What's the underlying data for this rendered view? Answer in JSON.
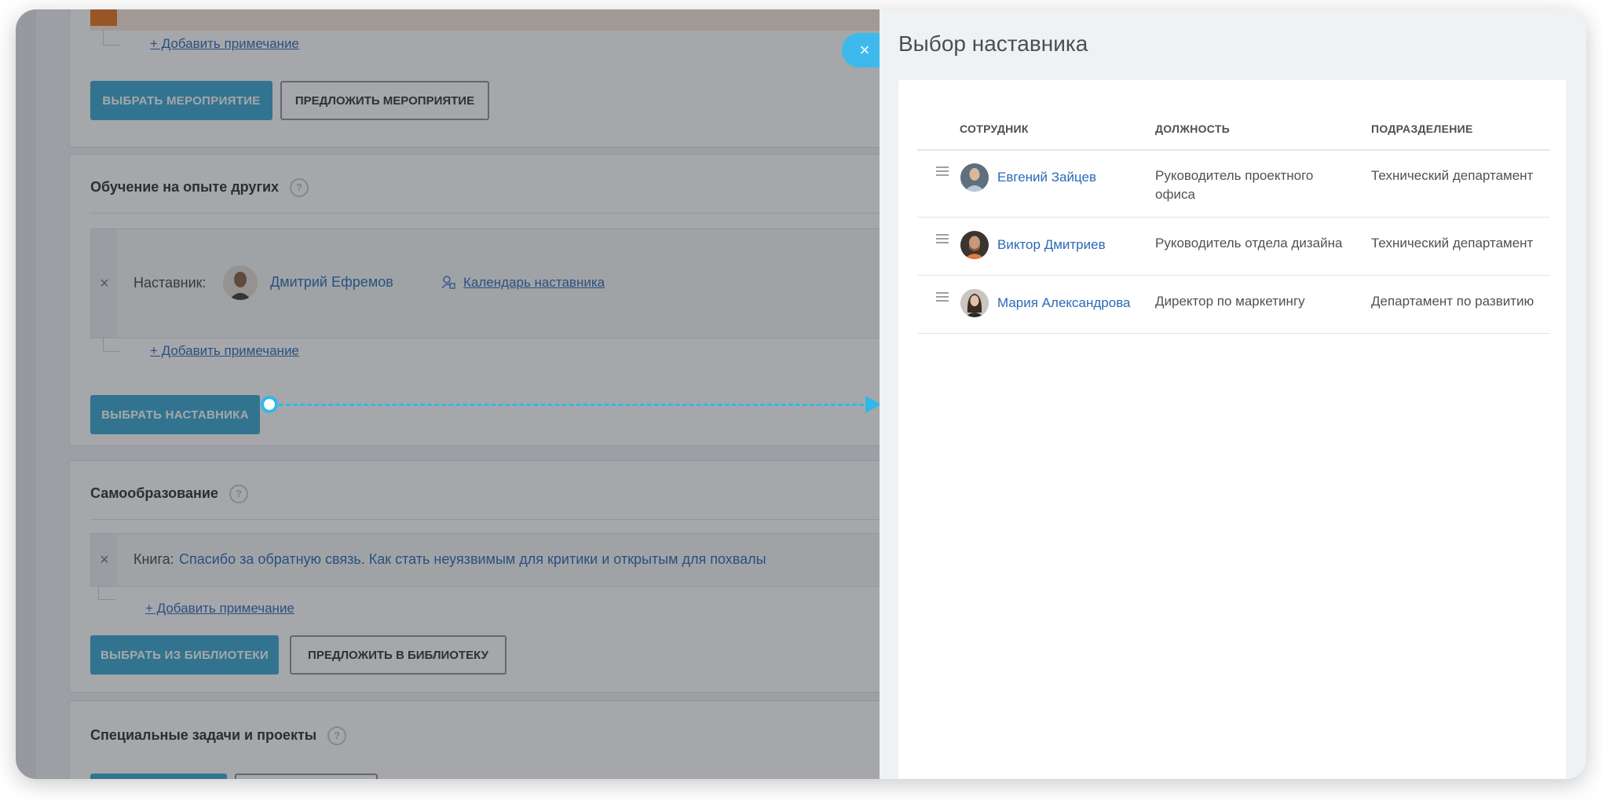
{
  "background_page": {
    "top_card": {
      "add_note": "+ Добавить примечание",
      "select_button": "Выбрать  мероприятие",
      "suggest_button": "Предложить мероприятие"
    },
    "mentoring_card": {
      "title": "Обучение на опыте других",
      "help": "?",
      "remove_icon": "×",
      "mentor_label": "Наставник:",
      "mentor_name": "Дмитрий Ефремов",
      "calendar_link": "Календарь наставника",
      "add_note": "+ Добавить примечание",
      "select_button": "Выбрать наставника"
    },
    "self_education_card": {
      "title": "Самообразование",
      "help": "?",
      "remove_icon": "×",
      "book_label": "Книга:",
      "book_title": "Спасибо за обратную связь. Как стать неуязвимым для критики и открытым для похвалы",
      "add_note": "+ Добавить примечание",
      "select_button": "Выбрать из библиотеки",
      "suggest_button": "Предложить в библиотеку"
    },
    "projects_card": {
      "title": "Специальные задачи и проекты",
      "help": "?"
    }
  },
  "panel": {
    "title": "Выбор наставника",
    "close_icon": "×",
    "columns": {
      "employee": "Сотрудник",
      "position": "Должность",
      "department": "Подразделение"
    },
    "rows": [
      {
        "name": "Евгений Зайцев",
        "position_line1": "Руководитель проектного",
        "position_line2": "офиса",
        "department": "Технический департамент"
      },
      {
        "name": "Виктор Дмитриев",
        "position_line1": "Руководитель отдела дизайна",
        "position_line2": "",
        "department": "Технический департамент"
      },
      {
        "name": "Мария Александрова",
        "position_line1": "Директор по маркетингу",
        "position_line2": "",
        "department": "Департамент по развитию"
      }
    ]
  },
  "colors": {
    "primary": "#3aa8d0",
    "accent": "#2fb9ea",
    "link": "#2a6ab7"
  }
}
